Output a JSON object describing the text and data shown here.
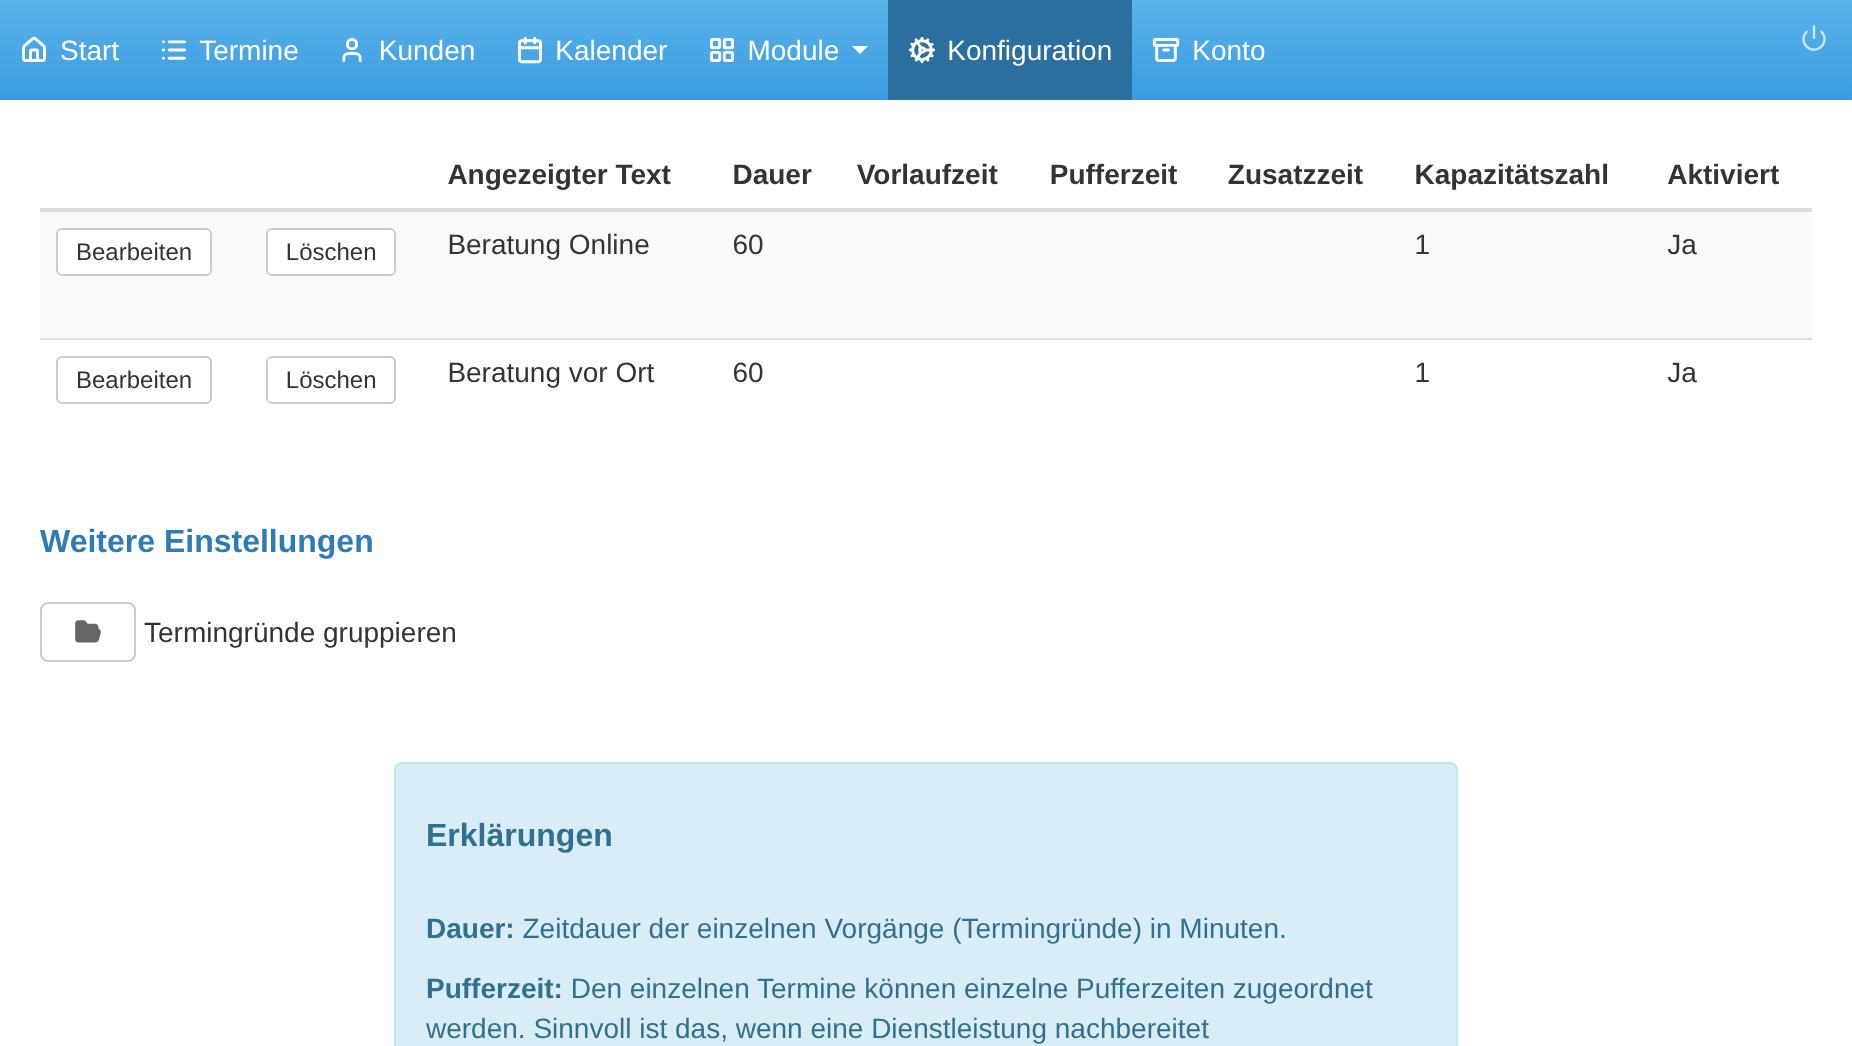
{
  "navbar": {
    "items": [
      {
        "label": "Start",
        "selected": false
      },
      {
        "label": "Termine",
        "selected": false
      },
      {
        "label": "Kunden",
        "selected": false
      },
      {
        "label": "Kalender",
        "selected": false
      },
      {
        "label": "Module",
        "selected": false,
        "dropdown": true
      },
      {
        "label": "Konfiguration",
        "selected": true
      },
      {
        "label": "Konto",
        "selected": false
      }
    ]
  },
  "table": {
    "columns": [
      "",
      "",
      "Angezeigter Text",
      "Dauer",
      "Vorlaufzeit",
      "Pufferzeit",
      "Zusatzzeit",
      "Kapazitätszahl",
      "Aktiviert"
    ],
    "rows": [
      {
        "edit": "Bearbeiten",
        "delete": "Löschen",
        "cells": [
          "Beratung Online",
          "60",
          "",
          "",
          "",
          "1",
          "Ja"
        ]
      },
      {
        "edit": "Bearbeiten",
        "delete": "Löschen",
        "cells": [
          "Beratung vor Ort",
          "60",
          "",
          "",
          "",
          "1",
          "Ja"
        ]
      }
    ]
  },
  "settings": {
    "title": "Weitere Einstellungen",
    "group_label": "Termingründe gruppieren"
  },
  "info": {
    "title": "Erklärungen",
    "paragraphs": [
      "**Dauer:** Zeitdauer der einzelnen Vorgänge (Termingründe) in Minuten.",
      "**Pufferzeit:** Den einzelnen Termine können einzelne Pufferzeiten zugeordnet werden. Sinnvoll ist das, wenn eine Dienstleistung nachbereitet"
    ]
  }
}
